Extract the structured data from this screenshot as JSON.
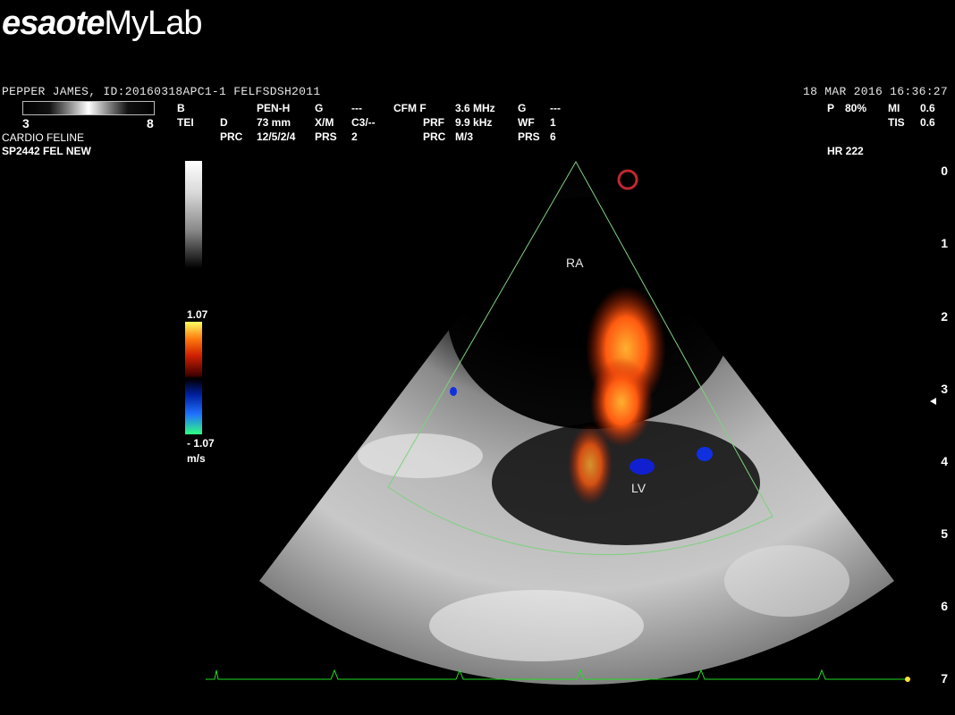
{
  "logo": {
    "brand": "esaote",
    "product": "MyLab"
  },
  "patient": {
    "line": "PEPPER JAMES, ID:20160318APC1-1  FELFSDSH2011",
    "datetime": "18  MAR  2016 16:36:27"
  },
  "gray_map": {
    "min": "3",
    "max": "8"
  },
  "preset": {
    "exam": "CARDIO FELINE",
    "probe": "SP2442  FEL NEW"
  },
  "params": {
    "b": "B",
    "tei": "TEI",
    "pen_h": "PEN-H",
    "d": "D",
    "d_val": "73 mm",
    "prc": "PRC",
    "prc_val": "12/5/2/4",
    "g": "G",
    "g_val": "---",
    "xm": "X/M",
    "xm_val": "C3/--",
    "prs": "PRS",
    "prs_val": "2",
    "cfm": "CFM F",
    "cfm_val": "3.6 MHz",
    "prf": "PRF",
    "prf_val": "9.9 kHz",
    "prc2": "PRC",
    "prc2_val": "M/3",
    "g2": "G",
    "g2_val": "---",
    "wf": "WF",
    "wf_val": "1",
    "prs2": "PRS",
    "prs2_val": "6"
  },
  "output": {
    "p": "P",
    "p_val": "80%",
    "mi": "MI",
    "mi_val": "0.6",
    "tis": "TIS",
    "tis_val": "0.6"
  },
  "hr": "HR 222",
  "color_scale": {
    "max": "1.07",
    "min": "- 1.07",
    "unit": "m/s"
  },
  "depth_scale": [
    "0",
    "1",
    "2",
    "3",
    "4",
    "5",
    "6",
    "7"
  ],
  "anatomy": {
    "ra": "RA",
    "lv": "LV"
  },
  "colors": {
    "ecg": "#22dd22",
    "sector_line": "#7fd07f",
    "logo_accent": "#c0282f"
  }
}
